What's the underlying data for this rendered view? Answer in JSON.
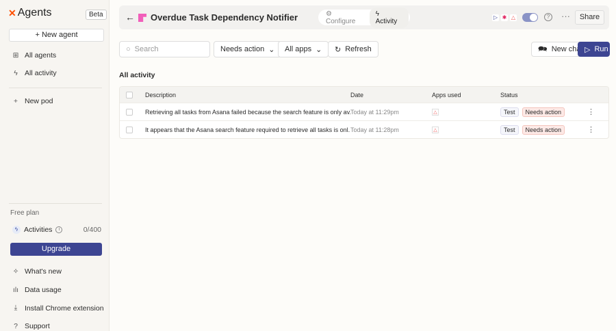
{
  "sidebar": {
    "logo": "Agents",
    "beta": "Beta",
    "new_agent": "New agent",
    "items": [
      {
        "label": "All agents",
        "icon": "grid-plus-icon"
      },
      {
        "label": "All activity",
        "icon": "bolt-icon"
      },
      {
        "label": "New pod",
        "icon": "plus-icon"
      }
    ],
    "plan": "Free plan",
    "activities_label": "Activities",
    "activities_count": "0/400",
    "upgrade": "Upgrade",
    "footer": [
      {
        "label": "What's new",
        "icon": "sparkle-icon"
      },
      {
        "label": "Data usage",
        "icon": "bar-chart-icon"
      },
      {
        "label": "Install Chrome extension",
        "icon": "download-icon"
      },
      {
        "label": "Support",
        "icon": "help-circle-icon"
      }
    ]
  },
  "header": {
    "title": "Overdue Task Dependency Notifier",
    "tabs": [
      "Configure",
      "Activity"
    ],
    "share": "Share"
  },
  "toolbar": {
    "search_placeholder": "Search",
    "filter_status": "Needs action",
    "filter_apps": "All apps",
    "refresh": "Refresh",
    "new_chat": "New chat",
    "run": "Run"
  },
  "section_title": "All activity",
  "table": {
    "columns": [
      "Description",
      "Date",
      "Apps used",
      "Status"
    ],
    "rows": [
      {
        "description": "Retrieving all tasks from Asana failed because the search feature is only av...",
        "date": "Today at 11:29pm",
        "tag": "Test",
        "status": "Needs action"
      },
      {
        "description": "It appears that the Asana search feature required to retrieve all tasks is onl...",
        "date": "Today at 11:28pm",
        "tag": "Test",
        "status": "Needs action"
      }
    ]
  },
  "colors": {
    "accent": "#3d4592",
    "brand": "#ff4f00"
  }
}
